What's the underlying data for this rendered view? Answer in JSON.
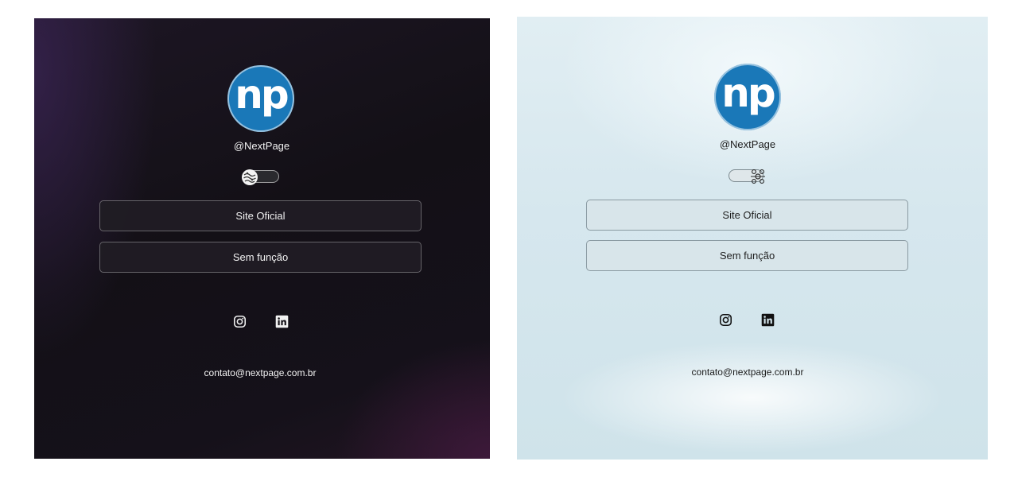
{
  "panels": [
    {
      "theme": "dark",
      "logo_text": "np",
      "handle": "@NextPage",
      "links": [
        {
          "label": "Site Oficial"
        },
        {
          "label": "Sem função"
        }
      ],
      "social": [
        "instagram-icon",
        "linkedin-icon"
      ],
      "email": "contato@nextpage.com.br",
      "toggle": {
        "state": "dark",
        "icon": "moon-icon"
      }
    },
    {
      "theme": "light",
      "logo_text": "np",
      "handle": "@NextPage",
      "links": [
        {
          "label": "Site Oficial"
        },
        {
          "label": "Sem função"
        }
      ],
      "social": [
        "instagram-icon",
        "linkedin-icon"
      ],
      "email": "contato@nextpage.com.br",
      "toggle": {
        "state": "light",
        "icon": "sun-icon"
      }
    }
  ],
  "colors": {
    "brand": "#1a78b8",
    "dark_bg": "#131016",
    "light_bg": "#d6e7ee"
  }
}
